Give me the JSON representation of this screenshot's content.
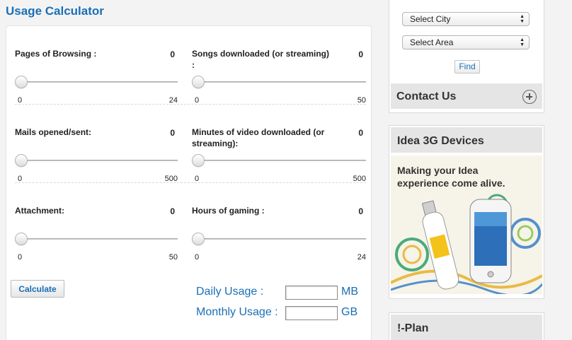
{
  "title": "Usage Calculator",
  "calculator": {
    "rows": [
      [
        {
          "label": "Pages of Browsing :",
          "value": "0",
          "min": "0",
          "max": "24",
          "level": 0
        },
        {
          "label": "Songs downloaded (or streaming) :",
          "value": "0",
          "min": "0",
          "max": "50",
          "level": 0
        }
      ],
      [
        {
          "label": "Mails opened/sent:",
          "value": "0",
          "min": "0",
          "max": "500",
          "level": 0
        },
        {
          "label": "Minutes of video downloaded (or streaming):",
          "value": "0",
          "min": "0",
          "max": "500",
          "level": 0
        }
      ],
      [
        {
          "label": "Attachment:",
          "value": "0",
          "min": "0",
          "max": "50",
          "level": 0
        },
        {
          "label": "Hours of gaming :",
          "value": "0",
          "min": "0",
          "max": "24",
          "level": 0
        }
      ]
    ],
    "calculate_label": "Calculate",
    "daily_label": "Daily Usage :",
    "daily_value": "",
    "daily_unit": "MB",
    "monthly_label": "Monthly Usage :",
    "monthly_value": "",
    "monthly_unit": "GB"
  },
  "sidebar": {
    "city_select": "Select City",
    "area_select": "Select Area",
    "find_label": "Find",
    "contact_title": "Contact Us",
    "devices_title": "Idea 3G Devices",
    "banner_text_1": "Making your Idea",
    "banner_text_2": "experience come alive.",
    "iplan_title": "!-Plan"
  },
  "colors": {
    "accent": "#1a6fb5",
    "panel_header": "#e5e5e5"
  }
}
